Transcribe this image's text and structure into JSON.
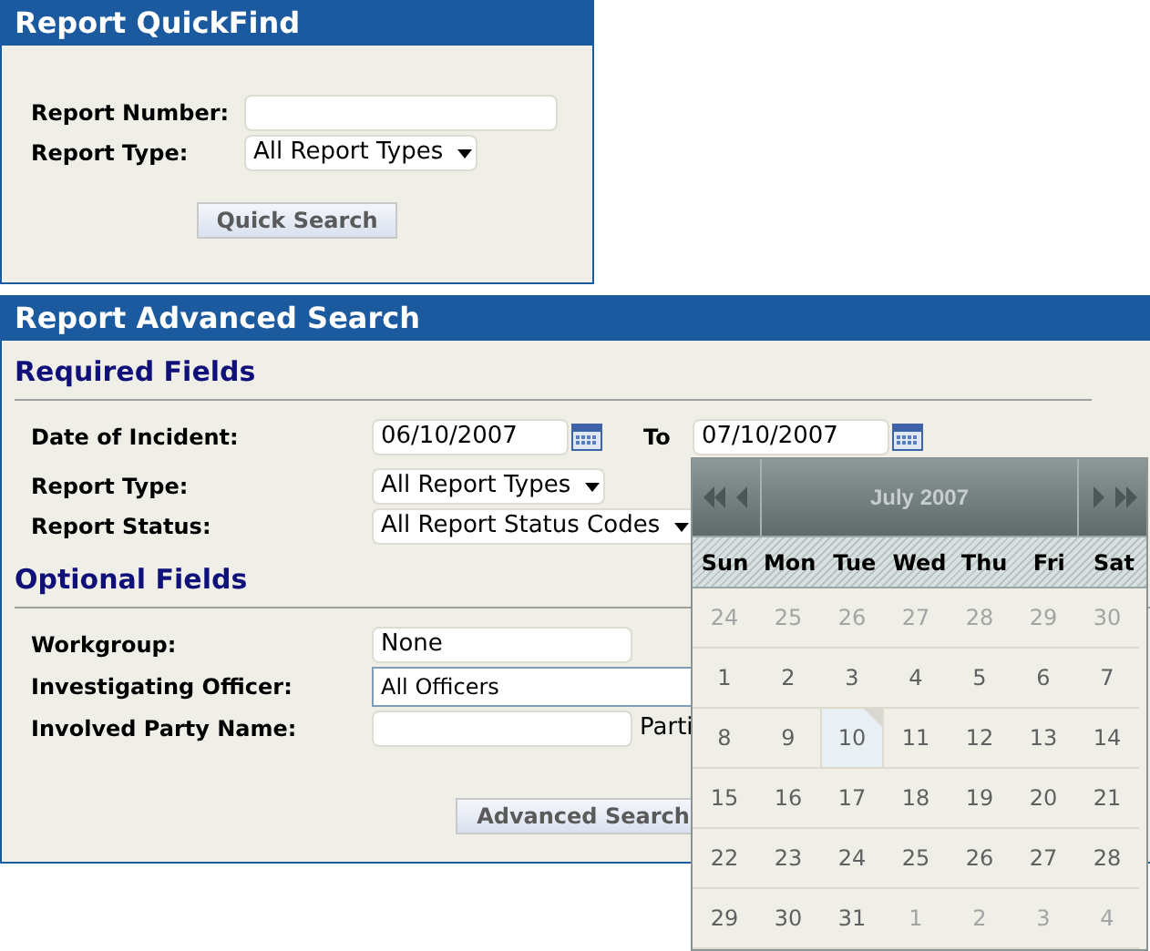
{
  "quickfind": {
    "title": "Report QuickFind",
    "fields": [
      {
        "label": "Report Number:",
        "kind": "text"
      },
      {
        "label": "Report Type:",
        "kind": "select",
        "value": "All Report Types"
      }
    ],
    "button": "Quick Search"
  },
  "advanced": {
    "title": "Report Advanced Search",
    "required": {
      "heading": "Required Fields",
      "date": {
        "label": "Date of Incident:",
        "from": "06/10/2007",
        "to_label": "To",
        "to": "07/10/2007"
      },
      "fields": [
        {
          "label": "Report Type:",
          "kind": "select",
          "value": "All Report Types"
        },
        {
          "label": "Report Status:",
          "kind": "select",
          "value": "All Report Status Codes"
        }
      ]
    },
    "optional": {
      "heading": "Optional Fields",
      "fields": [
        {
          "label": "Workgroup:",
          "kind": "text",
          "value": "None"
        },
        {
          "label": "Investigating Officer:",
          "kind": "wide",
          "value": "All Officers"
        },
        {
          "label": "Involved Party Name:",
          "kind": "text",
          "note": "Parti"
        }
      ]
    },
    "button": "Advanced Search"
  },
  "calendar": {
    "month": "July 2007",
    "weekdays": [
      "Sun",
      "Mon",
      "Tue",
      "Wed",
      "Thu",
      "Fri",
      "Sat"
    ],
    "days": [
      {
        "day": "24",
        "in_month": false,
        "selected": false
      },
      {
        "day": "25",
        "in_month": false,
        "selected": false
      },
      {
        "day": "26",
        "in_month": false,
        "selected": false
      },
      {
        "day": "27",
        "in_month": false,
        "selected": false
      },
      {
        "day": "28",
        "in_month": false,
        "selected": false
      },
      {
        "day": "29",
        "in_month": false,
        "selected": false
      },
      {
        "day": "30",
        "in_month": false,
        "selected": false
      },
      {
        "day": "1",
        "in_month": true,
        "selected": false
      },
      {
        "day": "2",
        "in_month": true,
        "selected": false
      },
      {
        "day": "3",
        "in_month": true,
        "selected": false
      },
      {
        "day": "4",
        "in_month": true,
        "selected": false
      },
      {
        "day": "5",
        "in_month": true,
        "selected": false
      },
      {
        "day": "6",
        "in_month": true,
        "selected": false
      },
      {
        "day": "7",
        "in_month": true,
        "selected": false
      },
      {
        "day": "8",
        "in_month": true,
        "selected": false
      },
      {
        "day": "9",
        "in_month": true,
        "selected": false
      },
      {
        "day": "10",
        "in_month": true,
        "selected": true
      },
      {
        "day": "11",
        "in_month": true,
        "selected": false
      },
      {
        "day": "12",
        "in_month": true,
        "selected": false
      },
      {
        "day": "13",
        "in_month": true,
        "selected": false
      },
      {
        "day": "14",
        "in_month": true,
        "selected": false
      },
      {
        "day": "15",
        "in_month": true,
        "selected": false
      },
      {
        "day": "16",
        "in_month": true,
        "selected": false
      },
      {
        "day": "17",
        "in_month": true,
        "selected": false
      },
      {
        "day": "18",
        "in_month": true,
        "selected": false
      },
      {
        "day": "19",
        "in_month": true,
        "selected": false
      },
      {
        "day": "20",
        "in_month": true,
        "selected": false
      },
      {
        "day": "21",
        "in_month": true,
        "selected": false
      },
      {
        "day": "22",
        "in_month": true,
        "selected": false
      },
      {
        "day": "23",
        "in_month": true,
        "selected": false
      },
      {
        "day": "24",
        "in_month": true,
        "selected": false
      },
      {
        "day": "25",
        "in_month": true,
        "selected": false
      },
      {
        "day": "26",
        "in_month": true,
        "selected": false
      },
      {
        "day": "27",
        "in_month": true,
        "selected": false
      },
      {
        "day": "28",
        "in_month": true,
        "selected": false
      },
      {
        "day": "29",
        "in_month": true,
        "selected": false
      },
      {
        "day": "30",
        "in_month": true,
        "selected": false
      },
      {
        "day": "31",
        "in_month": true,
        "selected": false
      },
      {
        "day": "1",
        "in_month": false,
        "selected": false
      },
      {
        "day": "2",
        "in_month": false,
        "selected": false
      },
      {
        "day": "3",
        "in_month": false,
        "selected": false
      },
      {
        "day": "4",
        "in_month": false,
        "selected": false
      }
    ]
  }
}
